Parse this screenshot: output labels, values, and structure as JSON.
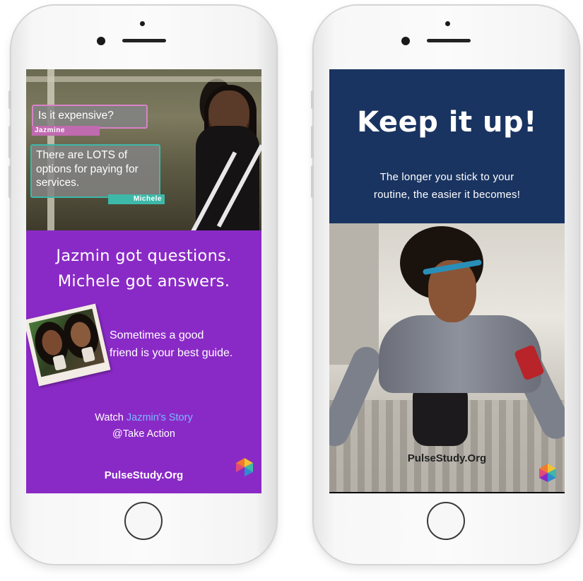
{
  "left_phone": {
    "bubble_question": "Is it expensive?",
    "bubble_question_name": "Jazmine",
    "bubble_answer": "There are LOTS of options for paying for services.",
    "bubble_answer_name": "Michele",
    "headline_line1": "Jazmin got questions.",
    "headline_line2": "Michele got answers.",
    "tagline_line1": "Sometimes a good",
    "tagline_line2": "friend is your best guide.",
    "watch_prefix": "Watch ",
    "watch_link": "Jazmin's Story",
    "watch_line2": "@Take Action",
    "site_url": "PulseStudy.Org"
  },
  "right_phone": {
    "title": "Keep it up!",
    "subtitle_line1": "The longer you stick to your",
    "subtitle_line2": "routine, the easier it becomes!",
    "site_url": "PulseStudy.Org"
  },
  "colors": {
    "purple_panel": "#8a2ac6",
    "navy_panel": "#1a3461",
    "link_blue": "#7ab8ff",
    "bubble_pink": "#d982c8",
    "bubble_teal": "#3eb8a8"
  },
  "icons": {
    "logo": "pulse-hexagon-logo",
    "home": "home-button"
  }
}
